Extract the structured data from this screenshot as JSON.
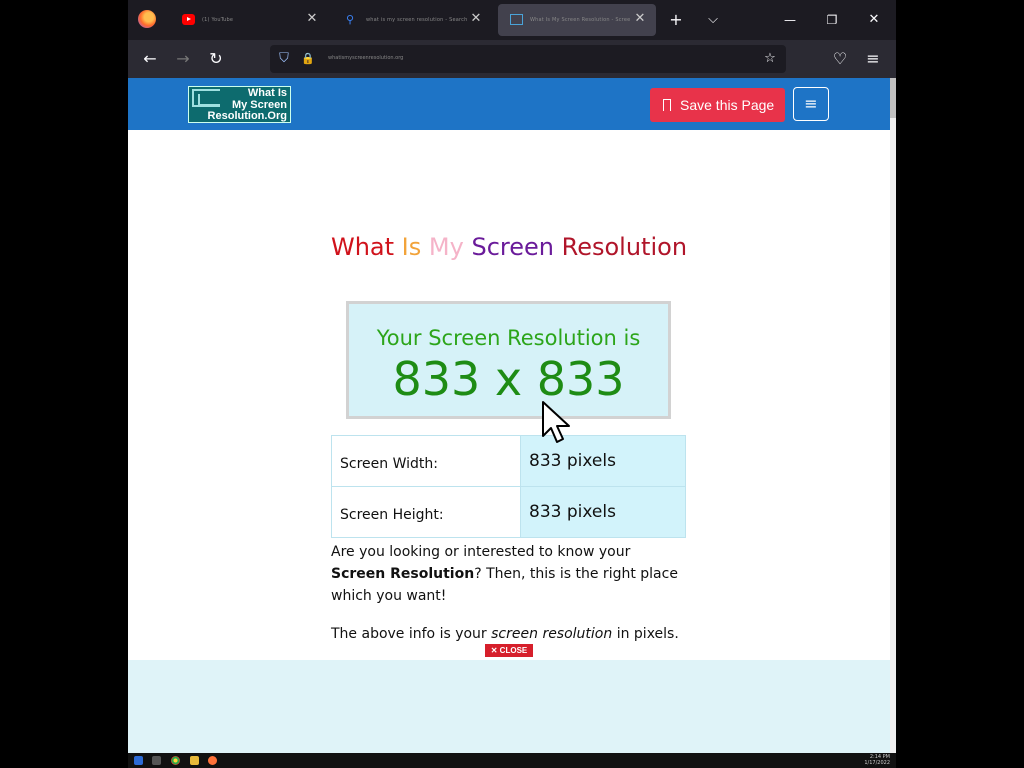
{
  "browser": {
    "tabs": [
      {
        "title": "(1) YouTube",
        "active": false
      },
      {
        "title": "what is my screen resolution - Search",
        "active": false
      },
      {
        "title": "What Is My Screen Resolution - Screen Size Check",
        "active": true
      }
    ],
    "url": "whatismyscreenresolution.org",
    "icons": {
      "new_tab": "+",
      "list_tabs": "⌵",
      "minimize": "—",
      "restore": "❐",
      "close_window": "✕",
      "back": "←",
      "forward": "→",
      "reload": "↻",
      "shield": "⛉",
      "lock": "🔒",
      "bookmark_star": "☆",
      "pocket": "♡",
      "app_menu": "≡",
      "tab_close": "✕"
    }
  },
  "site": {
    "logo_lines": [
      "What Is",
      "My Screen",
      "Resolution.Org"
    ],
    "save_label": "Save this Page",
    "menu_icon": "≡",
    "heading_words": [
      "What",
      "Is",
      "My",
      "Screen",
      "Resolution"
    ],
    "resolution_label": "Your Screen Resolution is",
    "resolution_value": "833 x 833",
    "table": [
      {
        "key": "Screen Width:",
        "value": "833 pixels"
      },
      {
        "key": "Screen Height:",
        "value": "833 pixels"
      }
    ],
    "para1_pre": "Are you looking or interested to know your ",
    "para1_bold": "Screen Resolution",
    "para1_post": "? Then, this is the right place which you want!",
    "para2_pre": "The above info is your ",
    "para2_italic": "screen resolution",
    "para2_post": " in pixels.",
    "close_label": "✕ CLOSE"
  },
  "taskbar": {
    "time": "2:14 PM",
    "date": "1/17/2022"
  },
  "colors": {
    "header": "#1e74c6",
    "save_button": "#e8334a",
    "resolution_green": "#1e8c14",
    "ad_area": "#dff3f8"
  }
}
